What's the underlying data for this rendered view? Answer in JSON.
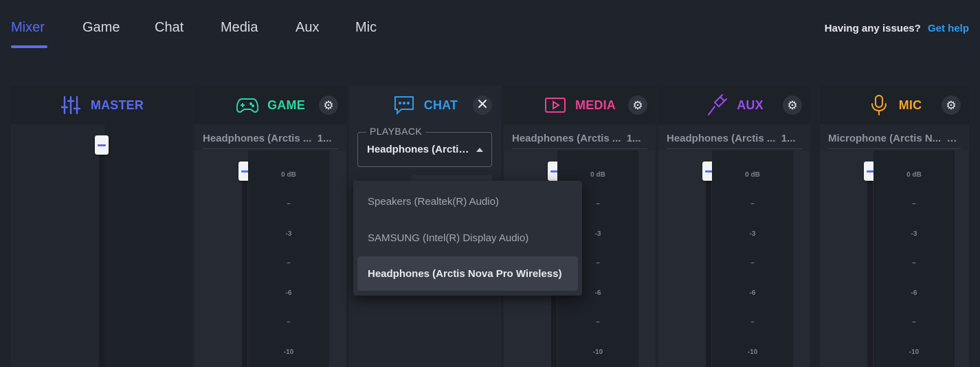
{
  "nav": {
    "tabs": [
      {
        "label": "Mixer"
      },
      {
        "label": "Game"
      },
      {
        "label": "Chat"
      },
      {
        "label": "Media"
      },
      {
        "label": "Aux"
      },
      {
        "label": "Mic"
      }
    ],
    "active_tab": "Mixer",
    "help_question": "Having any issues?",
    "help_link": "Get help"
  },
  "channels": {
    "master": {
      "title": "MASTER",
      "color": "#5b6cf0",
      "icon": "sliders-icon"
    },
    "game": {
      "title": "GAME",
      "color": "#2bd6a8",
      "icon": "gamepad-icon",
      "device": "Headphones (Arctis ...",
      "device_suffix": "1..."
    },
    "chat": {
      "title": "CHAT",
      "color": "#2f9bf0",
      "icon": "chat-bubble-icon"
    },
    "media": {
      "title": "MEDIA",
      "color": "#ef3f8e",
      "icon": "play-icon",
      "device": "Headphones (Arctis ...",
      "device_suffix": "1..."
    },
    "aux": {
      "title": "AUX",
      "color": "#9b4df0",
      "icon": "aux-cable-icon",
      "device": "Headphones (Arctis ...",
      "device_suffix": "1..."
    },
    "mic": {
      "title": "MIC",
      "color": "#f4a52a",
      "icon": "microphone-icon",
      "device": "Microphone (Arctis N...",
      "device_suffix": "1..."
    }
  },
  "scale_labels": [
    "0 dB",
    "–",
    "-3",
    "–",
    "-6",
    "–",
    "-10"
  ],
  "playback": {
    "legend": "PLAYBACK",
    "value": "Headphones (Arctis Nova Pro Wireless)",
    "options": [
      {
        "label": "Speakers (Realtek(R) Audio)"
      },
      {
        "label": "SAMSUNG (Intel(R) Display Audio)"
      },
      {
        "label": "Headphones (Arctis Nova Pro Wireless)"
      }
    ]
  }
}
